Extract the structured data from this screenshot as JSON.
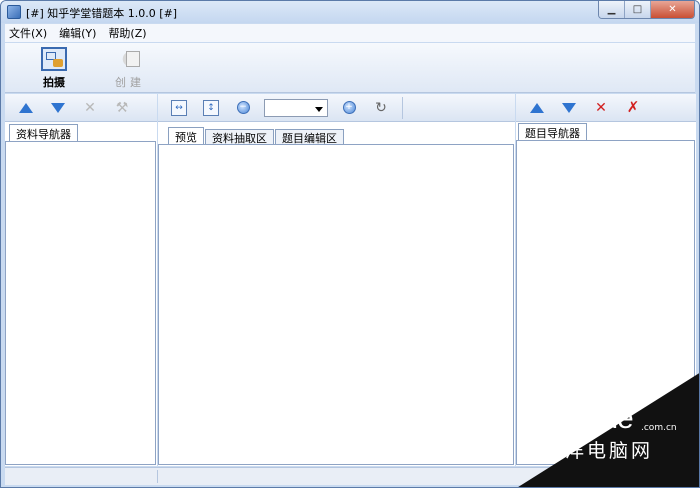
{
  "window": {
    "title": "[#] 知乎学堂错题本 1.0.0  [#]",
    "controls": {
      "minimize": "▁",
      "maximize": "□",
      "close": "✕"
    }
  },
  "menu": {
    "items": [
      "文件(X)",
      "编辑(Y)",
      "帮助(Z)"
    ]
  },
  "main_toolbar": {
    "capture_label": "拍摄",
    "create_label": "创建",
    "create_enabled": false
  },
  "left_panel": {
    "icons": [
      "move-up-icon",
      "move-down-icon",
      "delete-icon",
      "tools-icon"
    ],
    "tabs": [
      {
        "label": "资料导航器",
        "active": true
      }
    ]
  },
  "center_panel": {
    "icons": [
      "fit-width-icon",
      "fit-height-icon",
      "zoom-out-icon",
      "zoom-combo",
      "zoom-in-icon",
      "rotate-icon"
    ],
    "zoom_value": "",
    "tabs": [
      {
        "label": "预览",
        "active": true
      },
      {
        "label": "资料抽取区",
        "active": false
      },
      {
        "label": "题目编辑区",
        "active": false
      }
    ]
  },
  "right_panel": {
    "icons": [
      "move-up-icon",
      "move-down-icon",
      "delete-icon",
      "clear-icon"
    ],
    "tabs": [
      {
        "label": "题目导航器",
        "active": true
      }
    ]
  },
  "watermark": {
    "brand": "PConline",
    "domain": ".com.cn",
    "chinese": "太平洋电脑网"
  },
  "colors": {
    "accent_blue": "#2f74d0",
    "delete_red": "#d22020",
    "frame": "#c9daf0"
  }
}
